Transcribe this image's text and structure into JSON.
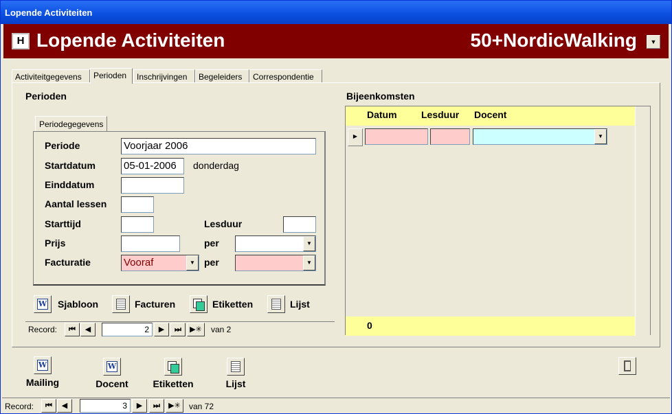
{
  "window": {
    "title": "Lopende Activiteiten"
  },
  "header": {
    "title": "Lopende Activiteiten",
    "organisation": "50+NordicWalking",
    "icon": "H"
  },
  "tabs": [
    {
      "label": "Activiteitgegevens",
      "active": false
    },
    {
      "label": "Perioden",
      "active": true
    },
    {
      "label": "Inschrijvingen",
      "active": false
    },
    {
      "label": "Begeleiders",
      "active": false
    },
    {
      "label": "Correspondentie",
      "active": false
    }
  ],
  "perioden": {
    "section_title": "Perioden",
    "subtab": "Periodegegevens",
    "labels": {
      "periode": "Periode",
      "startdatum": "Startdatum",
      "einddatum": "Einddatum",
      "aantal_lessen": "Aantal lessen",
      "starttijd": "Starttijd",
      "lesduur": "Lesduur",
      "prijs": "Prijs",
      "per1": "per",
      "facturatie": "Facturatie",
      "per2": "per"
    },
    "values": {
      "periode": "Voorjaar 2006",
      "startdatum": "05-01-2006",
      "startdag": "donderdag",
      "einddatum": "",
      "aantal_lessen": "",
      "starttijd": "",
      "lesduur": "",
      "prijs": "",
      "prijs_per": "",
      "facturatie": "Vooraf",
      "facturatie_per": ""
    },
    "buttons": {
      "sjabloon": "Sjabloon",
      "facturen": "Facturen",
      "etiketten": "Etiketten",
      "lijst": "Lijst"
    },
    "record": {
      "label": "Record:",
      "current": "2",
      "total": "van 2"
    }
  },
  "bijeenkomsten": {
    "section_title": "Bijeenkomsten",
    "columns": [
      "Datum",
      "Lesduur",
      "Docent"
    ],
    "footer_count": "0"
  },
  "bottom_buttons": {
    "mailing": "Mailing",
    "docent": "Docent",
    "etiketten": "Etiketten",
    "lijst": "Lijst"
  },
  "record": {
    "label": "Record:",
    "current": "3",
    "total": "van 72"
  },
  "nav_glyphs": {
    "first": "⏮",
    "prev": "◀",
    "next": "▶",
    "last": "⏭",
    "new": "▶✳",
    "dropdown": "▼",
    "row_selector": "▶"
  },
  "colors": {
    "header_bg": "#800000",
    "grid_header": "#ffff99",
    "pink_field": "#ffcccc",
    "cyan_field": "#ccffff"
  }
}
